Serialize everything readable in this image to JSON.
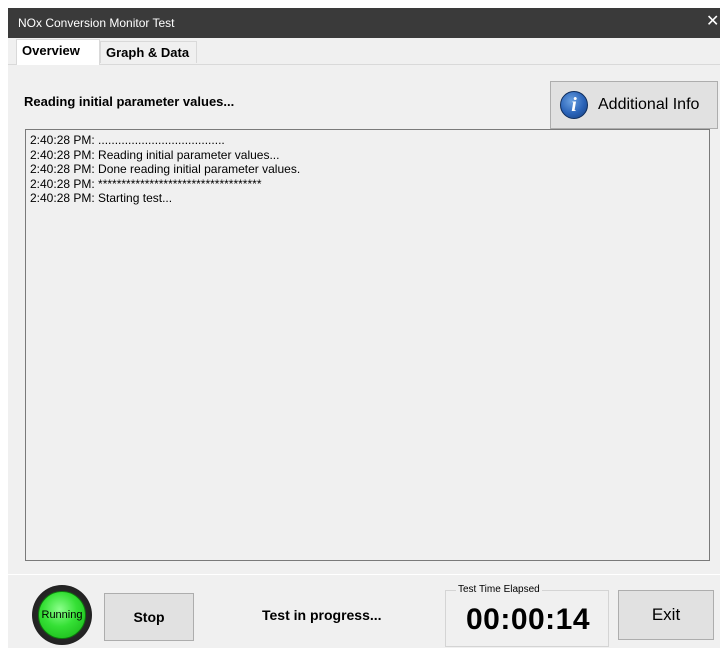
{
  "window": {
    "title": "NOx Conversion Monitor Test",
    "close_glyph": "✕"
  },
  "tabs": [
    {
      "label": "Overview",
      "active": true
    },
    {
      "label": "Graph & Data",
      "active": false
    }
  ],
  "status": {
    "heading": "Reading initial parameter values..."
  },
  "info_button": {
    "label": "Additional Info",
    "icon": "info-icon",
    "icon_glyph": "i"
  },
  "log": [
    "2:40:28 PM: ......................................",
    "2:40:28 PM: Reading initial parameter values...",
    "2:40:28 PM: Done reading initial parameter values.",
    "2:40:28 PM: ***********************************",
    "2:40:28 PM: Starting test..."
  ],
  "footer": {
    "indicator_label": "Running",
    "indicator_color": "#35e035",
    "stop_label": "Stop",
    "progress_text": "Test in progress...",
    "timer_caption": "Test Time Elapsed",
    "timer_value": "00:00:14",
    "exit_label": "Exit"
  }
}
